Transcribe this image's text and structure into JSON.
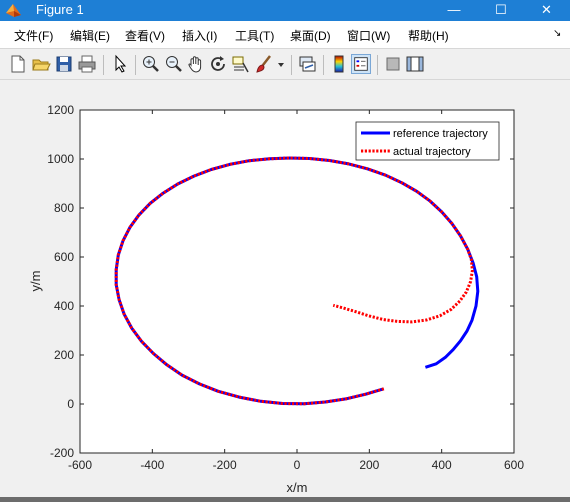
{
  "window": {
    "title": "Figure 1",
    "buttons": {
      "minimize": "—",
      "maximize": "☐",
      "close": "✕"
    },
    "title_bar_color": "#1e7fd5"
  },
  "menubar": {
    "items": [
      "文件(F)",
      "编辑(E)",
      "查看(V)",
      "插入(I)",
      "工具(T)",
      "桌面(D)",
      "窗口(W)",
      "帮助(H)"
    ],
    "overflow_glyph": "↘"
  },
  "toolbar": {
    "buttons": [
      {
        "icon": "new-figure-icon"
      },
      {
        "icon": "open-file-icon"
      },
      {
        "icon": "save-icon"
      },
      {
        "icon": "print-icon"
      },
      {
        "icon": "edit-plot-arrow-icon"
      },
      {
        "icon": "zoom-in-icon"
      },
      {
        "icon": "zoom-out-icon"
      },
      {
        "icon": "pan-hand-icon"
      },
      {
        "icon": "rotate-3d-icon"
      },
      {
        "icon": "data-cursor-icon"
      },
      {
        "icon": "brush-icon"
      },
      {
        "icon": "brush-dropdown-icon"
      },
      {
        "icon": "link-plot-icon"
      },
      {
        "icon": "insert-colorbar-icon"
      },
      {
        "icon": "insert-legend-icon"
      },
      {
        "icon": "hide-plot-tools-icon"
      },
      {
        "icon": "show-plot-tools-icon"
      }
    ]
  },
  "chart_data": {
    "type": "line",
    "title": "",
    "xlabel": "x/m",
    "ylabel": "y/m",
    "xlim": [
      -600,
      600
    ],
    "ylim": [
      -200,
      1200
    ],
    "xticks": [
      -600,
      -400,
      -200,
      0,
      200,
      400,
      600
    ],
    "yticks": [
      -200,
      0,
      200,
      400,
      600,
      800,
      1000,
      1200
    ],
    "grid": false,
    "legend_position": "top-right",
    "series": [
      {
        "name": "reference trajectory",
        "color": "#0000ff",
        "style": "solid",
        "x": [
          240,
          190,
          135,
          78,
          20,
          -40,
          -100,
          -160,
          -218,
          -270,
          -318,
          -360,
          -397,
          -430,
          -457,
          -478,
          -492,
          -500,
          -500,
          -494,
          -481,
          -462,
          -437,
          -406,
          -370,
          -330,
          -285,
          -237,
          -186,
          -132,
          -76,
          -20,
          35,
          90,
          143,
          195,
          245,
          290,
          331,
          368,
          400,
          428,
          452,
          472,
          487,
          497,
          500,
          495,
          484,
          470,
          452,
          432,
          410,
          385,
          355
        ],
        "y": [
          62,
          40,
          21,
          8,
          1,
          2,
          11,
          28,
          52,
          82,
          118,
          160,
          206,
          256,
          310,
          367,
          426,
          487,
          548,
          608,
          666,
          721,
          772,
          819,
          861,
          898,
          930,
          957,
          978,
          993,
          1001,
          1004,
          1002,
          994,
          980,
          960,
          934,
          903,
          868,
          828,
          784,
          737,
          686,
          632,
          576,
          519,
          460,
          400,
          342,
          298,
          258,
          222,
          190,
          164,
          150
        ]
      },
      {
        "name": "actual trajectory",
        "color": "#ff0000",
        "style": "dotted",
        "x": [
          240,
          190,
          135,
          78,
          20,
          -40,
          -100,
          -160,
          -218,
          -270,
          -318,
          -360,
          -397,
          -430,
          -457,
          -478,
          -492,
          -500,
          -500,
          -494,
          -481,
          -462,
          -437,
          -406,
          -370,
          -330,
          -285,
          -237,
          -186,
          -132,
          -76,
          -20,
          35,
          90,
          143,
          195,
          245,
          290,
          331,
          368,
          400,
          428,
          452,
          472,
          482,
          485,
          480,
          468,
          450,
          426,
          395,
          358,
          318,
          278,
          238,
          198,
          160,
          128,
          100
        ],
        "y": [
          62,
          40,
          21,
          8,
          1,
          2,
          11,
          28,
          52,
          82,
          118,
          160,
          206,
          256,
          310,
          367,
          426,
          487,
          548,
          608,
          666,
          721,
          772,
          819,
          861,
          898,
          930,
          957,
          978,
          993,
          1001,
          1004,
          1002,
          994,
          980,
          960,
          934,
          903,
          868,
          828,
          784,
          737,
          686,
          632,
          590,
          545,
          500,
          457,
          420,
          386,
          360,
          343,
          335,
          337,
          345,
          360,
          378,
          392,
          403
        ]
      }
    ]
  }
}
